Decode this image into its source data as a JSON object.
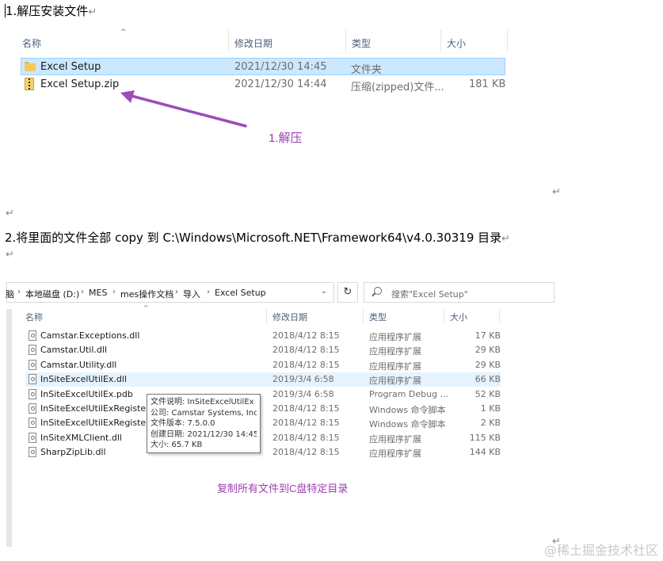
{
  "doc": {
    "step1": "1.解压安装文件",
    "step2": "2.将里面的文件全部 copy 到  C:\\Windows\\Microsoft.NET\\Framework64\\v4.0.30319  目录",
    "para_mark": "↵"
  },
  "explorer1": {
    "columns": [
      "名称",
      "修改日期",
      "类型",
      "大小"
    ],
    "rows": [
      {
        "name": "Excel Setup",
        "date": "2021/12/30 14:45",
        "type": "文件夹",
        "size": "",
        "icon": "folder-icon"
      },
      {
        "name": "Excel Setup.zip",
        "date": "2021/12/30 14:44",
        "type": "压缩(zipped)文件...",
        "size": "181 KB",
        "icon": "zip-icon"
      }
    ],
    "annotation": "1.解压",
    "arrow_color": "#9b4db8"
  },
  "explorer2": {
    "breadcrumb": [
      "脑",
      "本地磁盘 (D:)",
      "MES",
      "mes操作文档",
      "导入",
      "Excel Setup"
    ],
    "search_placeholder": "搜索\"Excel Setup\"",
    "columns": [
      "名称",
      "修改日期",
      "类型",
      "大小"
    ],
    "rows": [
      {
        "name": "Camstar.Exceptions.dll",
        "date": "2018/4/12 8:15",
        "type": "应用程序扩展",
        "size": "17 KB"
      },
      {
        "name": "Camstar.Util.dll",
        "date": "2018/4/12 8:15",
        "type": "应用程序扩展",
        "size": "29 KB"
      },
      {
        "name": "Camstar.Utility.dll",
        "date": "2018/4/12 8:15",
        "type": "应用程序扩展",
        "size": "29 KB"
      },
      {
        "name": "InSiteExcelUtilEx.dll",
        "date": "2019/3/4 6:58",
        "type": "应用程序扩展",
        "size": "66 KB"
      },
      {
        "name": "InSiteExcelUtilEx.pdb",
        "date": "2019/3/4 6:58",
        "type": "Program Debug ...",
        "size": "52 KB"
      },
      {
        "name": "InSiteExcelUtilExRegister.cm",
        "date": "2018/4/12 8:15",
        "type": "Windows 命令脚本",
        "size": "1 KB"
      },
      {
        "name": "InSiteExcelUtilExRegisterFo",
        "date": "2018/4/12 8:15",
        "type": "Windows 命令脚本",
        "size": "2 KB"
      },
      {
        "name": "InSiteXMLClient.dll",
        "date": "2018/4/12 8:15",
        "type": "应用程序扩展",
        "size": "115 KB"
      },
      {
        "name": "SharpZipLib.dll",
        "date": "2018/4/12 8:15",
        "type": "应用程序扩展",
        "size": "144 KB"
      }
    ],
    "tooltip": [
      "文件说明: InSiteExcelUtilEx",
      "公司: Camstar Systems, Inc.",
      "文件版本: 7.5.0.0",
      "创建日期: 2021/12/30 14:45",
      "大小: 65.7 KB"
    ],
    "annotation": "复制所有文件到C盘特定目录"
  },
  "watermark": "@稀土掘金技术社区",
  "colors": {
    "selection": "#cce8ff",
    "annotation": "#9b3fb0"
  }
}
